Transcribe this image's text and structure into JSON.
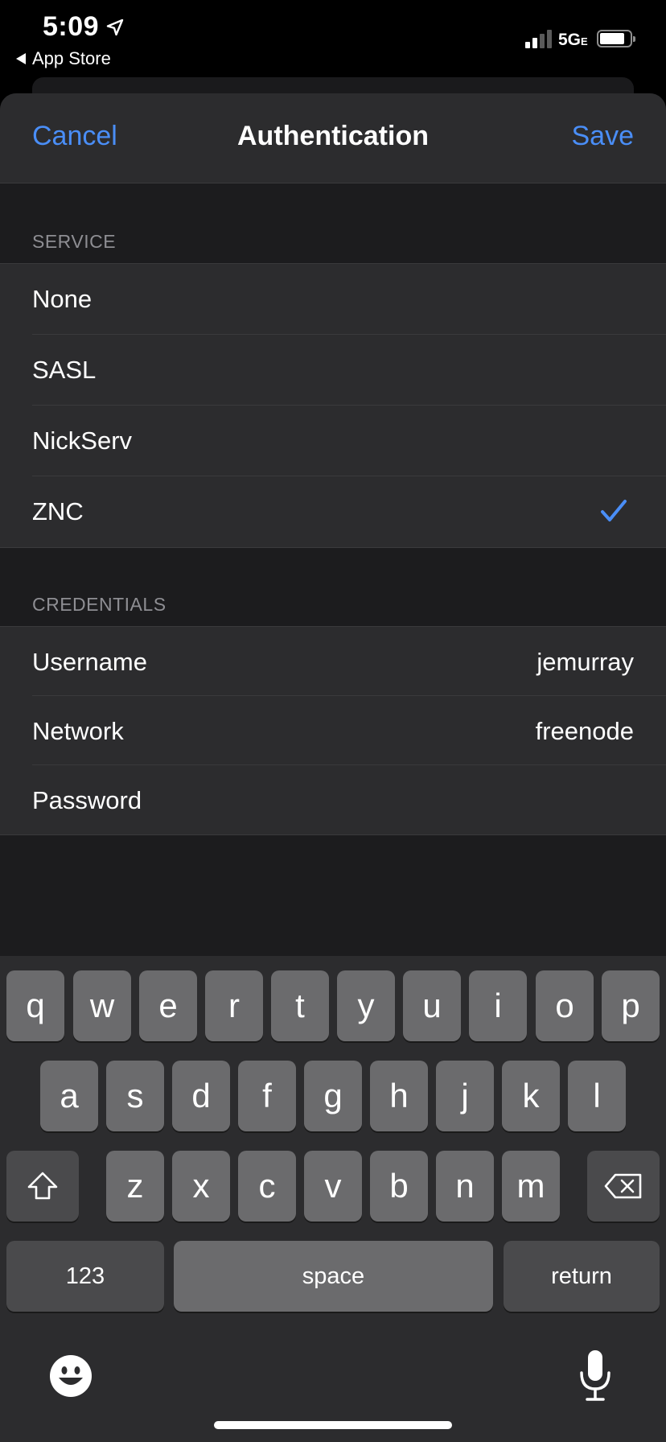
{
  "status_bar": {
    "time": "5:09",
    "back_label": "App Store",
    "network": "5G",
    "network_suffix": "E",
    "icons": [
      "location-arrow-icon",
      "signal-bars-icon",
      "battery-icon"
    ]
  },
  "nav": {
    "cancel_label": "Cancel",
    "title": "Authentication",
    "save_label": "Save"
  },
  "service": {
    "header": "SERVICE",
    "options": [
      {
        "label": "None",
        "selected": false
      },
      {
        "label": "SASL",
        "selected": false
      },
      {
        "label": "NickServ",
        "selected": false
      },
      {
        "label": "ZNC",
        "selected": true
      }
    ]
  },
  "credentials": {
    "header": "CREDENTIALS",
    "rows": [
      {
        "label": "Username",
        "value": "jemurray"
      },
      {
        "label": "Network",
        "value": "freenode"
      },
      {
        "label": "Password",
        "value": ""
      }
    ]
  },
  "keyboard": {
    "row1": [
      "q",
      "w",
      "e",
      "r",
      "t",
      "y",
      "u",
      "i",
      "o",
      "p"
    ],
    "row2": [
      "a",
      "s",
      "d",
      "f",
      "g",
      "h",
      "j",
      "k",
      "l"
    ],
    "row3": [
      "z",
      "x",
      "c",
      "v",
      "b",
      "n",
      "m"
    ],
    "numbers_label": "123",
    "space_label": "space",
    "return_label": "return",
    "icons": [
      "shift-icon",
      "delete-icon",
      "emoji-icon",
      "microphone-icon"
    ]
  },
  "colors": {
    "accent": "#4a8ef7",
    "sheet_bg": "#1c1c1e",
    "cell_bg": "#2c2c2e",
    "key_bg": "#6b6b6d"
  }
}
